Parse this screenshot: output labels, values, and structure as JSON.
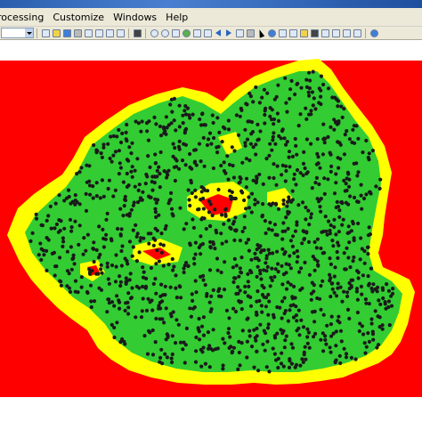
{
  "menubar": {
    "processing": "rocessing",
    "customize": "Customize",
    "windows": "Windows",
    "help": "Help"
  },
  "toolbar": {
    "icons": [
      "dropdown-selector",
      "new-document-icon",
      "open-icon",
      "save-icon",
      "print-icon",
      "cut-icon",
      "copy-icon",
      "paste-icon",
      "delete-icon",
      "undo-icon",
      "redo-icon",
      "add-data-icon",
      "zoom-in-icon",
      "zoom-out-icon",
      "pan-icon",
      "full-extent-icon",
      "fixed-zoom-icon",
      "back-extent-icon",
      "forward-extent-icon",
      "select-features-icon",
      "select-pointer-icon",
      "identify-icon",
      "find-icon",
      "measure-icon",
      "hyperlink-icon",
      "search-icon",
      "catalog-icon",
      "toolbox-icon",
      "python-icon",
      "model-builder-icon",
      "arcgis-online-icon"
    ]
  },
  "map": {
    "background_color": "#ff0000",
    "colors": {
      "buffer_outer": "#ffff00",
      "buffer_inner": "#33cc33",
      "points": "#1a1a1a",
      "unsuitable": "#ff0000"
    },
    "layers": [
      "unsuitable-zone",
      "outer-buffer",
      "inner-buffer",
      "settlement-points"
    ]
  }
}
